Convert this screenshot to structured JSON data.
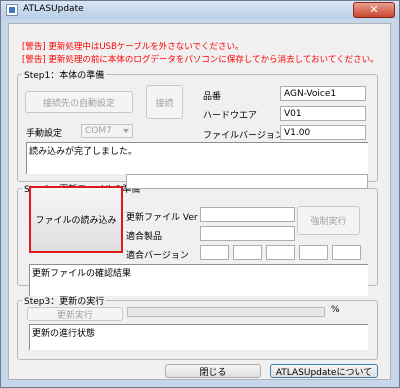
{
  "window": {
    "title": "ATLASUpdate",
    "close_symbol": "✕"
  },
  "warnings": [
    "[警告] 更新処理中はUSBケーブルを外さないでください。",
    "[警告] 更新処理の前に本体のログデータをパソコンに保存してから消去しておいてください。"
  ],
  "step1": {
    "legend": "Step1：本体の準備",
    "auto_button": "接続先の自動設定",
    "connect_button": "接続",
    "manual_label": "手動設定",
    "port_value": "COM7",
    "model_label": "品番",
    "model_value": "AGN-Voice1",
    "hardware_label": "ハードウエア",
    "hardware_value": "V01",
    "firmware_label": "ファイルバージョン",
    "firmware_value": "V1.00",
    "status": "読み込みが完了しました。"
  },
  "step2": {
    "legend": "Step2：更新ファイルの準備",
    "read_button": "ファイルの読み込み",
    "file_path": "",
    "update_ver_label": "更新ファイル Ver",
    "update_ver_value": "",
    "product_label": "適合製品",
    "product_value": "",
    "version_label": "適合バージョン",
    "version_values": [
      "",
      "",
      "",
      "",
      ""
    ],
    "force_button": "強制実行",
    "result_status": "更新ファイルの確認結果"
  },
  "step3": {
    "legend": "Step3：更新の実行",
    "update_button": "更新実行",
    "progress_fraction": 0,
    "percent_label": "%",
    "status": "更新の進行状態"
  },
  "footer": {
    "close_button": "閉じる",
    "about_button": "ATLASUpdateについて"
  },
  "colors": {
    "warning": "#ff0000",
    "focus_border": "#e0191e",
    "window_frame": "#c7d7ea"
  }
}
